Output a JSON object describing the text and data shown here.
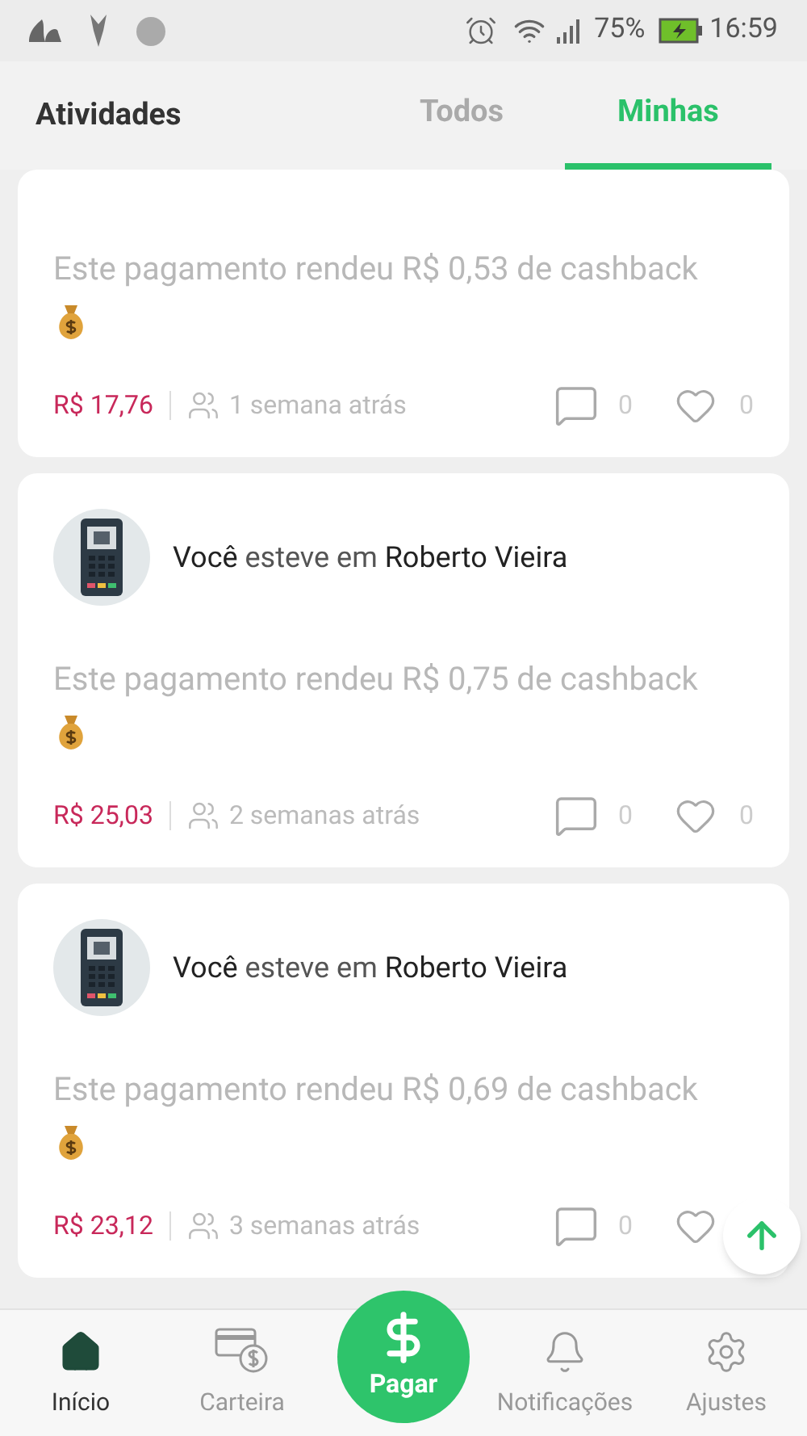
{
  "status_bar": {
    "battery": "75%",
    "time": "16:59"
  },
  "header": {
    "title": "Atividades",
    "tabs": [
      {
        "label": "Todos",
        "selected": false
      },
      {
        "label": "Minhas",
        "selected": true
      }
    ]
  },
  "feed": [
    {
      "partial": true,
      "message": "Este pagamento rendeu R$ 0,53 de cashback",
      "amount": "R$ 17,76",
      "time": "1 semana atrás",
      "comments": "0",
      "likes": "0"
    },
    {
      "partial": false,
      "subject": "Você",
      "verb": "esteve em",
      "place": "Roberto Vieira",
      "message": "Este pagamento rendeu R$ 0,75 de cashback",
      "amount": "R$ 25,03",
      "time": "2 semanas atrás",
      "comments": "0",
      "likes": "0"
    },
    {
      "partial": false,
      "subject": "Você",
      "verb": "esteve em",
      "place": "Roberto Vieira",
      "message": "Este pagamento rendeu R$ 0,69 de cashback",
      "amount": "R$ 23,12",
      "time": "3 semanas atrás",
      "comments": "0"
    }
  ],
  "bottom_nav": [
    {
      "label": "Início",
      "kind": "tab",
      "selected": true
    },
    {
      "label": "Carteira",
      "kind": "tab",
      "selected": false
    },
    {
      "label": "Pagar",
      "kind": "primary",
      "selected": false
    },
    {
      "label": "Notificações",
      "kind": "tab",
      "selected": false
    },
    {
      "label": "Ajustes",
      "kind": "tab",
      "selected": false
    }
  ]
}
